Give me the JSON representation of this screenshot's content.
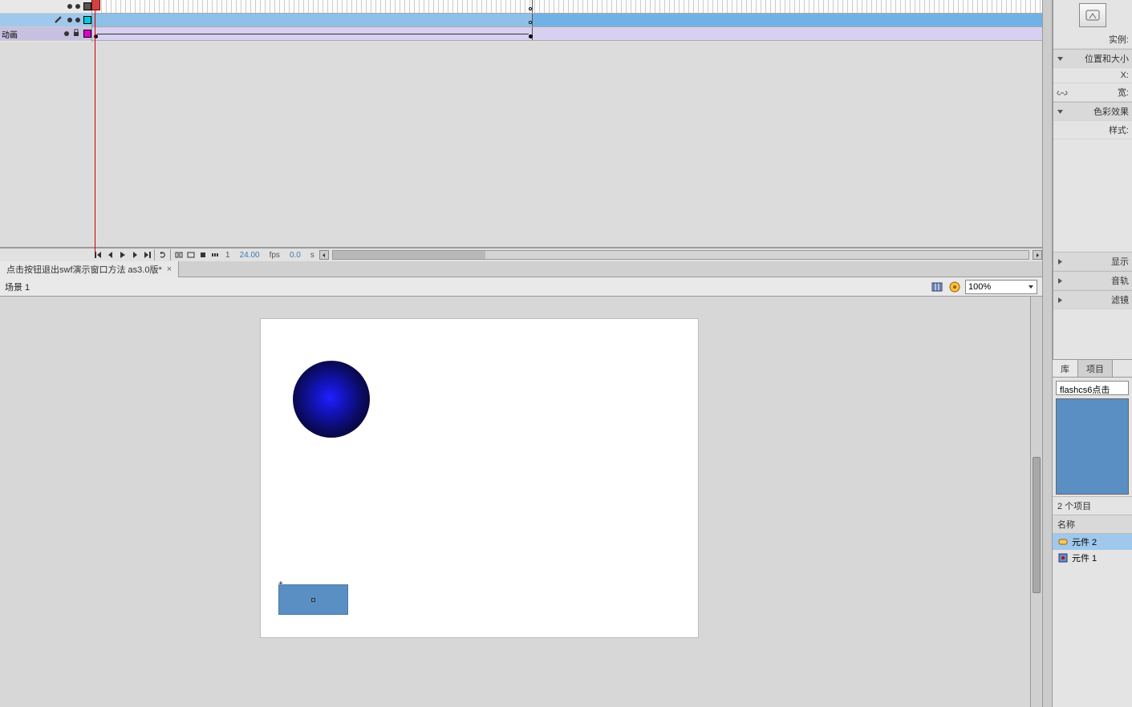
{
  "timeline": {
    "layers": [
      {
        "name": "",
        "color": "#555555"
      },
      {
        "name": "",
        "color": "#00ccdd",
        "selected": true
      },
      {
        "name": "动画",
        "color": "#dd00cc",
        "locked": true
      }
    ],
    "playback": {
      "frame": "1",
      "fps": "24.00",
      "fps_unit": "fps",
      "time": "0.0",
      "time_unit": "s"
    }
  },
  "doc_tab": {
    "title": "点击按钮退出swf演示窗口方法 as3.0版*",
    "close": "×"
  },
  "scene": {
    "label": "场景 1"
  },
  "zoom": {
    "value": "100%"
  },
  "properties": {
    "instance_label": "实例:",
    "pos_size_label": "位置和大小",
    "x_label": "X:",
    "w_label": "宽:",
    "color_effect_label": "色彩效果",
    "style_label": "样式:",
    "display_label": "显示",
    "audio_label": "音轨",
    "filter_label": "滤镜"
  },
  "library": {
    "tab1": "库",
    "tab2": "项目",
    "doc_name": "flashcs6点击",
    "count": "2 个项目",
    "header": "名称",
    "items": [
      {
        "name": "元件 2",
        "type": "button"
      },
      {
        "name": "元件 1",
        "type": "movieclip"
      }
    ]
  }
}
